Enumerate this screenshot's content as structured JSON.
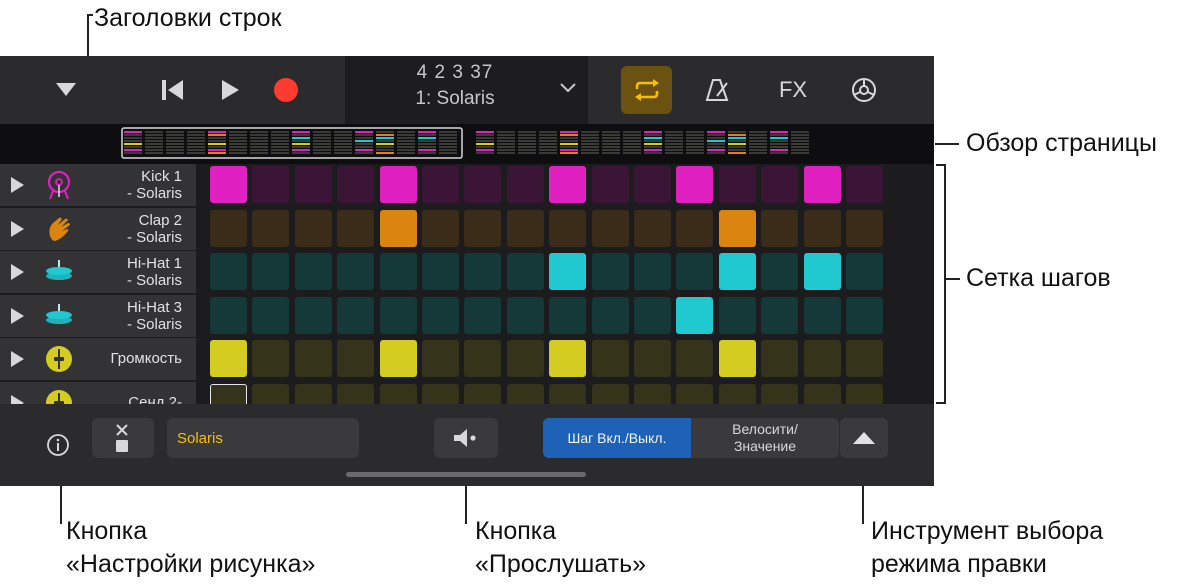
{
  "annotations": {
    "row_headers": "Заголовки строк",
    "page_overview": "Обзор страницы",
    "step_grid": "Сетка шагов",
    "pattern_settings_line1": "Кнопка",
    "pattern_settings_line2": "«Настройки рисунка»",
    "audition_line1": "Кнопка",
    "audition_line2": "«Прослушать»",
    "edit_mode_line1": "Инструмент выбора",
    "edit_mode_line2": "режима правки"
  },
  "toolbar": {
    "position": "4  2  3     37",
    "pattern_name": "1: Solaris",
    "fx_label": "FX"
  },
  "colors": {
    "accent_loop": "#f6c000",
    "record": "#ff3b30",
    "kick": "#e020c0",
    "clap": "#e08a10",
    "hihat": "#20c8d0",
    "volume": "#d8d020"
  },
  "rows": [
    {
      "label_line1": "Kick 1",
      "label_line2": "- Solaris",
      "icon": "kick-drum-icon",
      "color": "#e020c0",
      "dim": "#3a1535",
      "steps": [
        1,
        0,
        0,
        0,
        1,
        0,
        0,
        0,
        1,
        0,
        0,
        1,
        0,
        0,
        1,
        0
      ]
    },
    {
      "label_line1": "Clap 2",
      "label_line2": "- Solaris",
      "icon": "clap-hand-icon",
      "color": "#d98510",
      "dim": "#3a2c18",
      "steps": [
        0,
        0,
        0,
        0,
        1,
        0,
        0,
        0,
        0,
        0,
        0,
        0,
        1,
        0,
        0,
        0
      ]
    },
    {
      "label_line1": "Hi-Hat 1",
      "label_line2": "- Solaris",
      "icon": "hihat-cymbal-icon",
      "color": "#20c8d0",
      "dim": "#153838",
      "steps": [
        0,
        0,
        0,
        0,
        0,
        0,
        0,
        0,
        1,
        0,
        0,
        0,
        1,
        0,
        1,
        0
      ]
    },
    {
      "label_line1": "Hi-Hat 3",
      "label_line2": "- Solaris",
      "icon": "hihat-cymbal-icon",
      "color": "#20c8d0",
      "dim": "#153838",
      "steps": [
        0,
        0,
        0,
        0,
        0,
        0,
        0,
        0,
        0,
        0,
        0,
        1,
        0,
        0,
        0,
        0
      ]
    },
    {
      "label_line1": "Громкость",
      "label_line2": "",
      "icon": "volume-fader-icon",
      "color": "#d4cc20",
      "dim": "#35331a",
      "steps": [
        1,
        0,
        0,
        0,
        1,
        0,
        0,
        0,
        1,
        0,
        0,
        0,
        1,
        0,
        0,
        0
      ]
    },
    {
      "label_line1": "Сенд 2-",
      "label_line2": "",
      "icon": "volume-fader-icon",
      "color": "#d4cc20",
      "dim": "#35331a",
      "steps": [
        0,
        0,
        0,
        0,
        0,
        0,
        0,
        0,
        0,
        0,
        0,
        0,
        0,
        0,
        0,
        0
      ]
    }
  ],
  "bottombar": {
    "pattern_name_field": "Solaris",
    "step_on_off": "Шаг Вкл./Выкл.",
    "velocity_line1": "Велосити/",
    "velocity_line2": "Значение"
  }
}
